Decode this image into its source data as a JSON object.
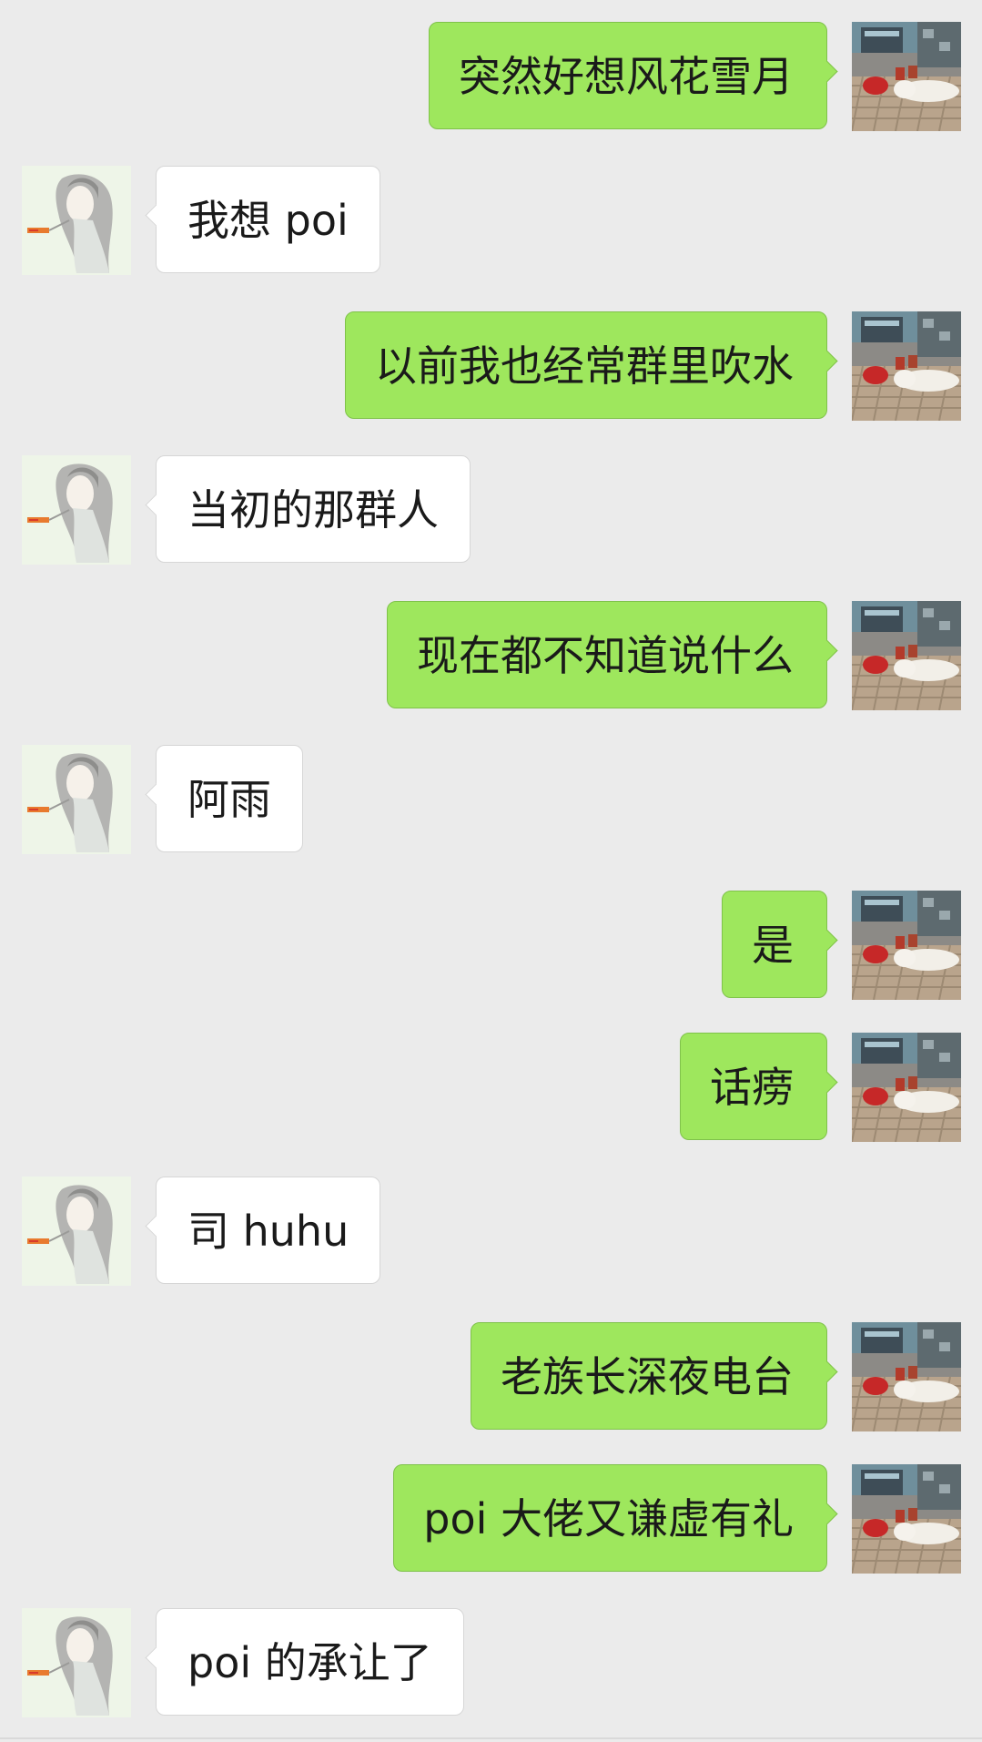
{
  "messages": [
    {
      "side": "out",
      "text": "突然好想风花雪月"
    },
    {
      "side": "in",
      "text": "我想 poi"
    },
    {
      "side": "out",
      "text": "以前我也经常群里吹水"
    },
    {
      "side": "in",
      "text": "当初的那群人"
    },
    {
      "side": "out",
      "text": "现在都不知道说什么"
    },
    {
      "side": "in",
      "text": "阿雨"
    },
    {
      "side": "out",
      "text": "是"
    },
    {
      "side": "out",
      "text": "话痨"
    },
    {
      "side": "in",
      "text": "司 huhu"
    },
    {
      "side": "out",
      "text": "老族长深夜电台"
    },
    {
      "side": "out",
      "text": "poi 大佬又谦虚有礼"
    },
    {
      "side": "in",
      "text": "poi 的承让了"
    }
  ],
  "colors": {
    "background": "#ebebeb",
    "outgoing_bubble": "#9ee75d",
    "incoming_bubble": "#ffffff"
  },
  "icons": {
    "outgoing_avatar": "dog-on-pavement-photo-avatar",
    "incoming_avatar": "sketch-girl-portrait-avatar"
  }
}
